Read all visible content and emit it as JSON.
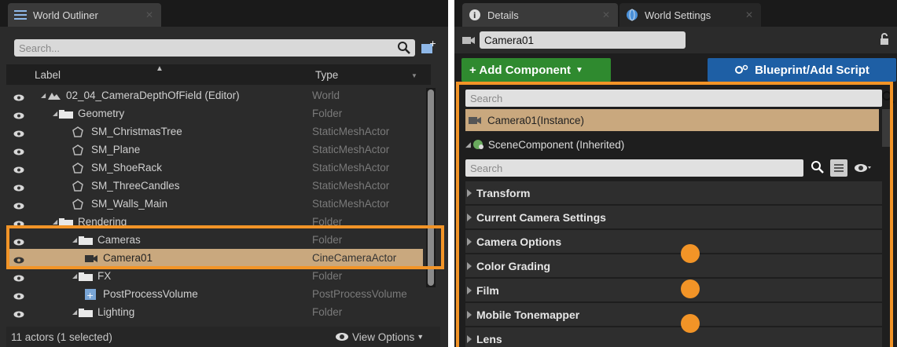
{
  "outliner": {
    "tab_label": "World Outliner",
    "search_placeholder": "Search...",
    "col_label": "Label",
    "col_type": "Type",
    "rows": [
      {
        "name": "02_04_CameraDepthOfField (Editor)",
        "type": "World"
      },
      {
        "name": "Geometry",
        "type": "Folder"
      },
      {
        "name": "SM_ChristmasTree",
        "type": "StaticMeshActor"
      },
      {
        "name": "SM_Plane",
        "type": "StaticMeshActor"
      },
      {
        "name": "SM_ShoeRack",
        "type": "StaticMeshActor"
      },
      {
        "name": "SM_ThreeCandles",
        "type": "StaticMeshActor"
      },
      {
        "name": "SM_Walls_Main",
        "type": "StaticMeshActor"
      },
      {
        "name": "Rendering",
        "type": "Folder"
      },
      {
        "name": "Cameras",
        "type": "Folder"
      },
      {
        "name": "Camera01",
        "type": "CineCameraActor"
      },
      {
        "name": "FX",
        "type": "Folder"
      },
      {
        "name": "PostProcessVolume",
        "type": "PostProcessVolume"
      },
      {
        "name": "Lighting",
        "type": "Folder"
      }
    ],
    "footer_count": "11 actors (1 selected)",
    "view_options": "View Options"
  },
  "details": {
    "tab_details": "Details",
    "tab_world_settings": "World Settings",
    "name_value": "Camera01",
    "add_component": "+ Add Component",
    "blueprint": "Blueprint/Add Script",
    "comp_search_placeholder": "Search",
    "instance_label": "Camera01(Instance)",
    "scene_component": "SceneComponent (Inherited)",
    "prop_search_placeholder": "Search",
    "categories": [
      "Transform",
      "Current Camera Settings",
      "Camera Options",
      "Color Grading",
      "Film",
      "Mobile Tonemapper",
      "Lens"
    ]
  },
  "colors": {
    "accent": "#f29427",
    "selection": "#c9a87e",
    "add_green": "#2f8a2f",
    "blueprint_blue": "#1e5fa5"
  }
}
